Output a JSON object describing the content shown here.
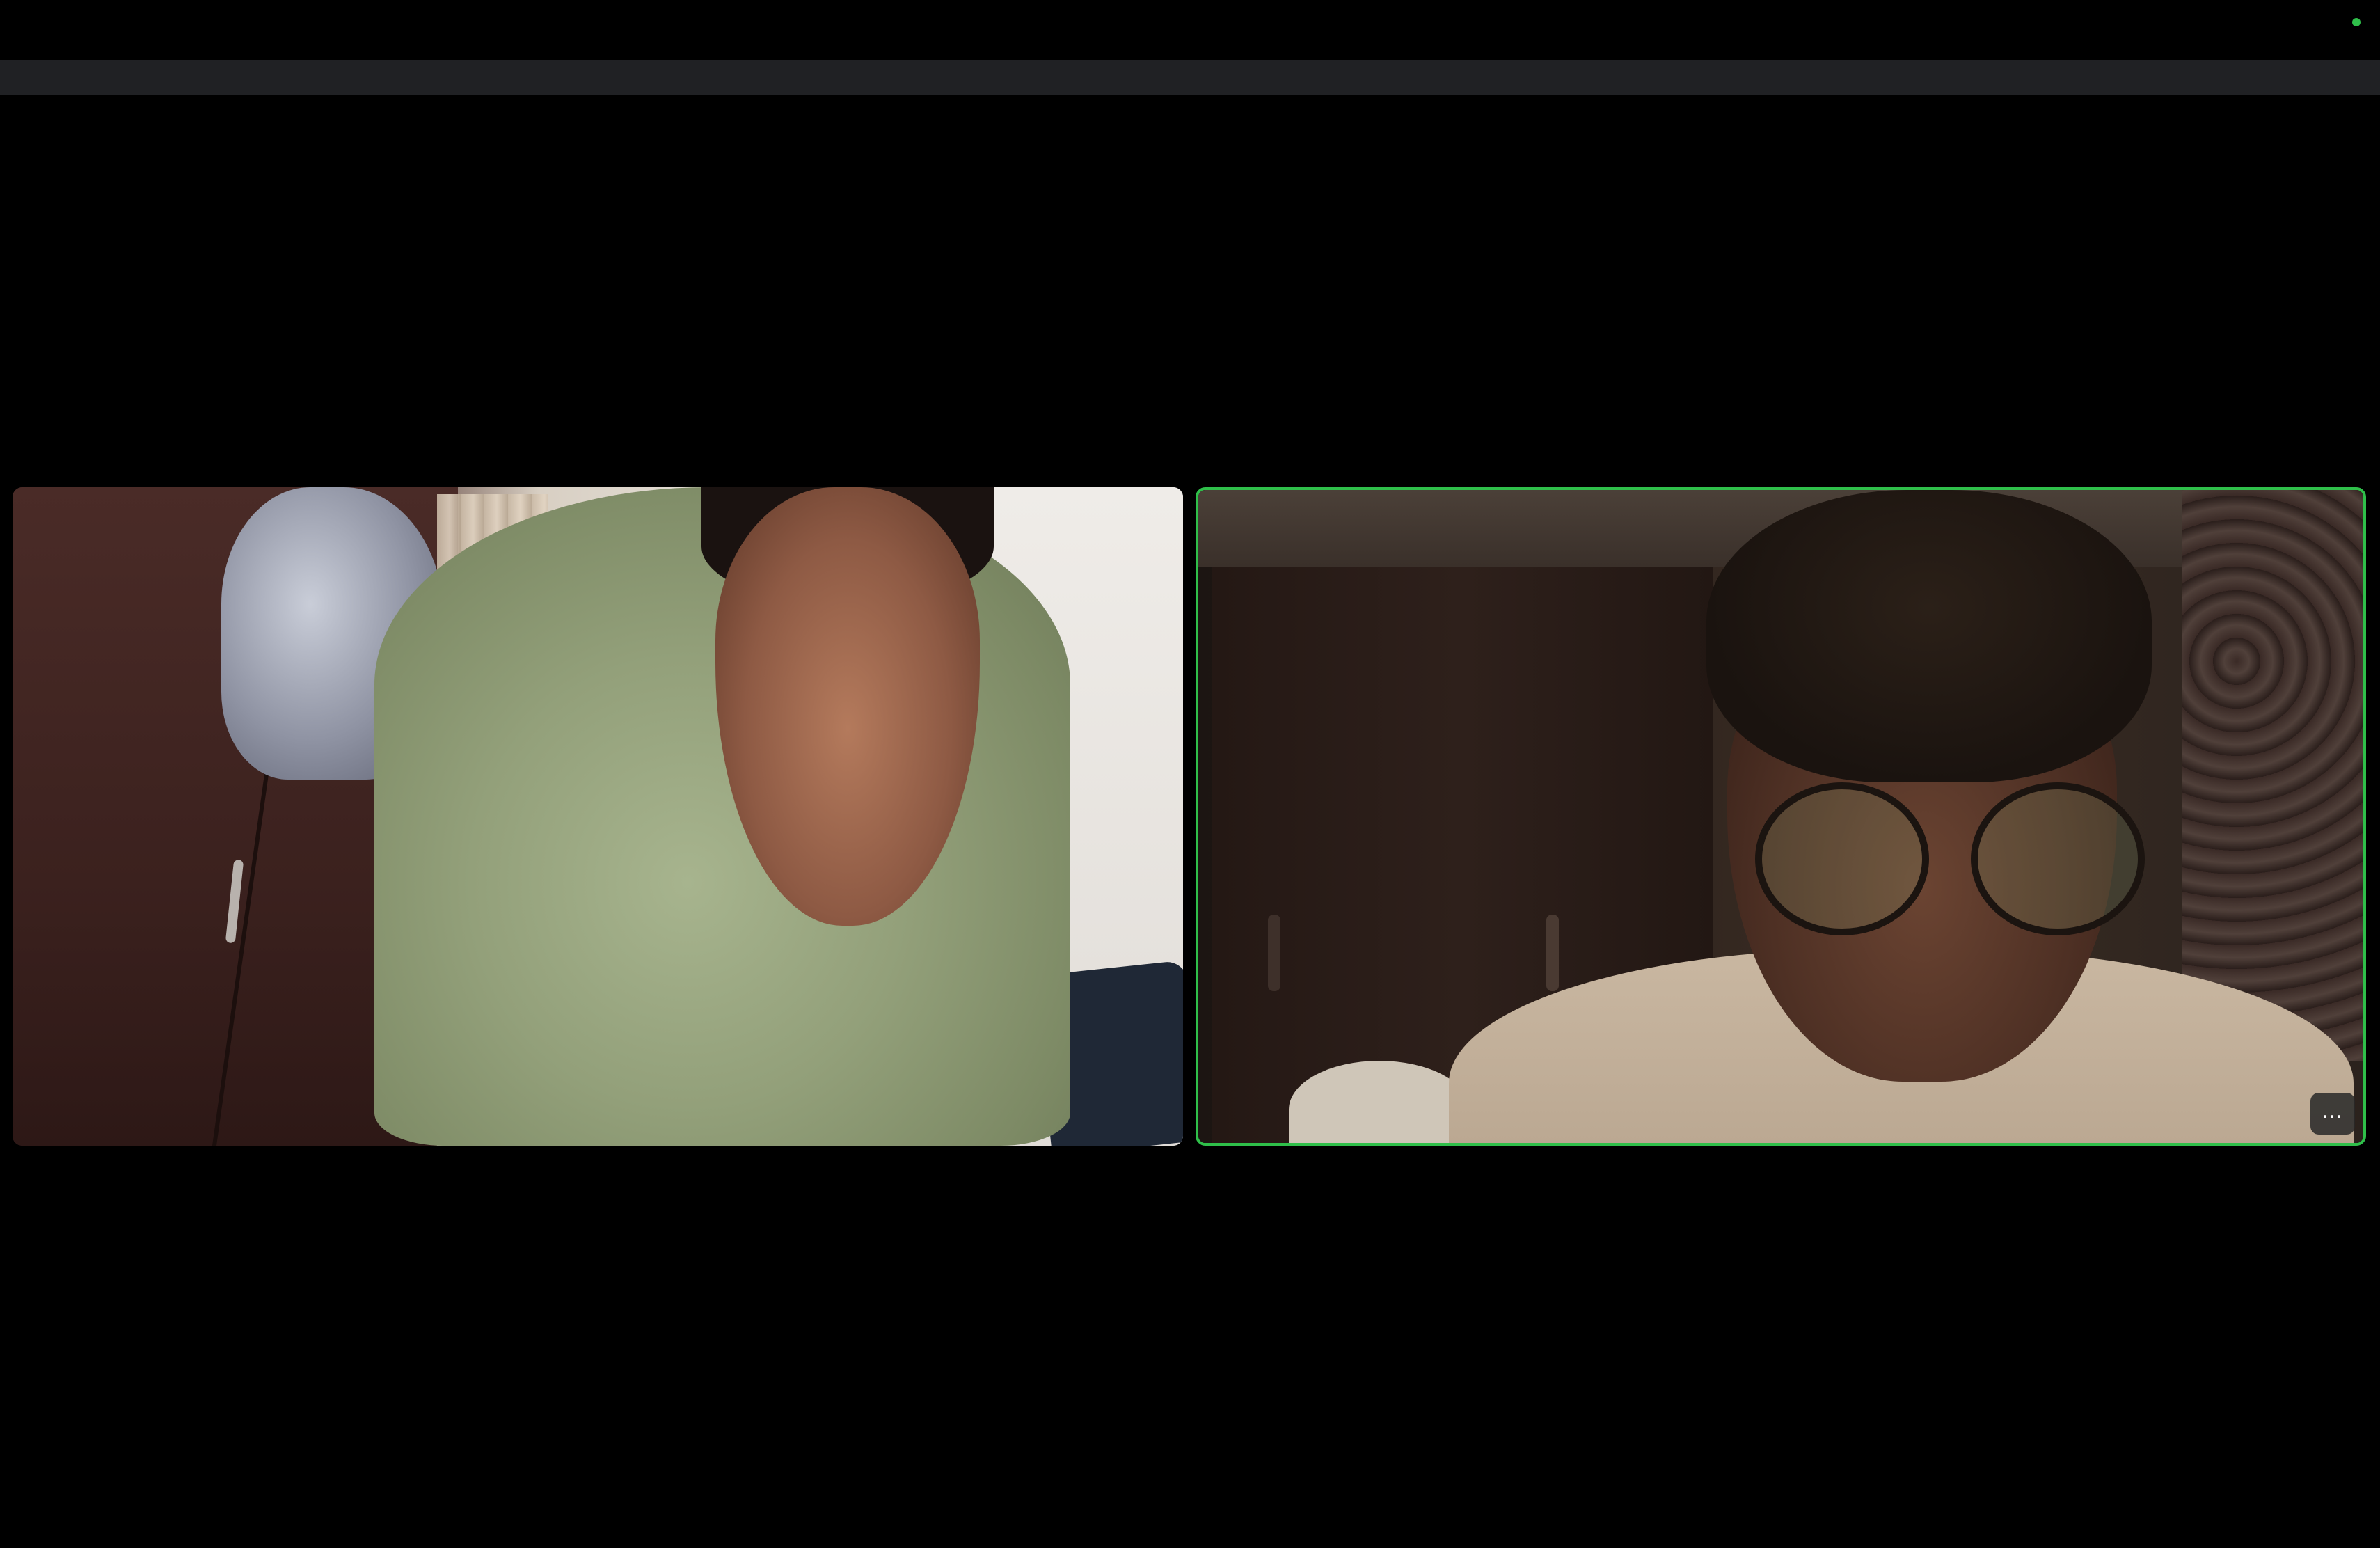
{
  "app": {
    "view": "gallery"
  },
  "colors": {
    "background": "#000000",
    "top_strip": "#202124",
    "status_indicator": "#2fbf4a",
    "active_speaker_border": "#2fbf4a"
  },
  "status_indicator": {
    "icon": "green-dot-icon"
  },
  "participants": [
    {
      "id": "left",
      "video_on": true,
      "active_speaker": false
    },
    {
      "id": "right",
      "video_on": true,
      "active_speaker": true,
      "more_button": {
        "label": "…",
        "icon": "ellipsis-icon"
      }
    }
  ]
}
